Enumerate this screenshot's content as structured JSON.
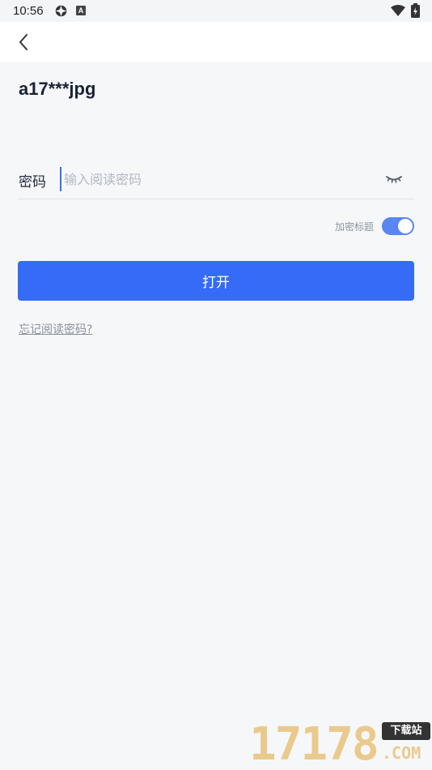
{
  "status_bar": {
    "time": "10:56",
    "notification_icons": [
      "gear-icon",
      "a-badge-icon"
    ],
    "a_badge": "A",
    "system_icons": [
      "wifi-icon",
      "battery-icon"
    ]
  },
  "header": {
    "back_icon": "chevron-left-icon"
  },
  "file": {
    "name": "a17***jpg"
  },
  "password": {
    "label": "密码",
    "placeholder": "输入阅读密码",
    "value": "",
    "visibility_icon": "eye-closed-icon"
  },
  "encrypt_title": {
    "label": "加密标题",
    "enabled": true
  },
  "actions": {
    "open_label": "打开",
    "forgot_label": "忘记阅读密码?"
  },
  "colors": {
    "accent": "#356bf7",
    "toggle_on": "#5a86f2",
    "background": "#f6f7f9"
  },
  "watermark": {
    "digits": "17178",
    "badge": "下载站",
    "suffix": ".COM"
  }
}
